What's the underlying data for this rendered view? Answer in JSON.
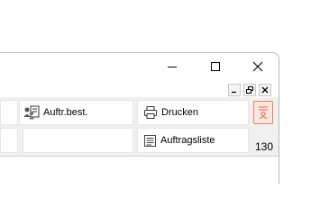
{
  "window": {
    "controls": [
      "minimize-icon",
      "maximize-icon",
      "close-icon"
    ],
    "mdi_controls": [
      "mdi-minimize-icon",
      "mdi-restore-icon",
      "mdi-close-icon"
    ]
  },
  "toolbar": {
    "auftr_best_label": "Auftr.best.",
    "drucken_label": "Drucken",
    "auftragsliste_label": "Auftragsliste",
    "count": "130"
  },
  "icons": {
    "auftr_best": "people-document-icon",
    "drucken": "printer-icon",
    "auftragsliste": "list-icon",
    "red_tool": "document-person-icon"
  },
  "colors": {
    "accent_red": "#e0816a",
    "accent_red_bg": "#fde6de"
  }
}
